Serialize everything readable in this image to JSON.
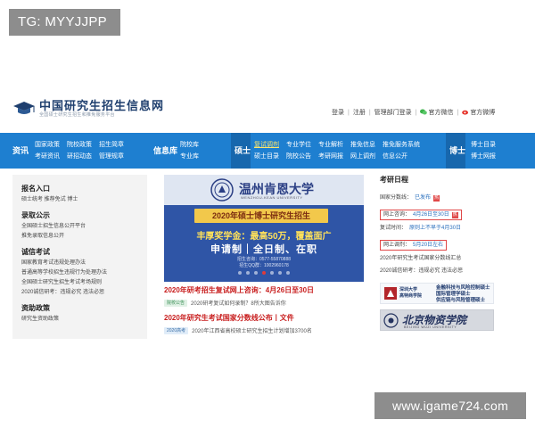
{
  "overlays": {
    "tag": "TG: MYYJJPP",
    "domain": "www.igame724.com"
  },
  "site": {
    "title": "中国研究生招生信息网",
    "subtitle": "全国硕士研究生招生和推免服务平台"
  },
  "top_links": {
    "login": "登录",
    "register": "注册",
    "admin_login": "管理部门登录",
    "wechat": "官方微信",
    "weibo": "官方微博"
  },
  "nav": {
    "groups": [
      {
        "head": "资讯",
        "items": [
          "国家政策",
          "考研资讯",
          "院校政策",
          "研招动态",
          "招生简章",
          "管理规章"
        ]
      },
      {
        "head": "信息库",
        "items": [
          "院校库",
          "专业库"
        ]
      },
      {
        "head": "硕士",
        "items": [
          "复试调剂",
          "硕士目录",
          "专业学位",
          "院校公告",
          "专业解析",
          "考研网报",
          "推免信息",
          "网上调剂",
          "推免服务系统",
          "信息公开"
        ]
      },
      {
        "head": "博士",
        "items": [
          "博士目录",
          "博士网报"
        ]
      }
    ]
  },
  "left": {
    "sections": [
      {
        "title": "报名入口",
        "items": [
          "硕士统考  推荐免试  博士"
        ]
      },
      {
        "title": "录取公示",
        "items": [
          "全国硕士招生信息公开平台",
          "推免录取信息公开"
        ]
      },
      {
        "title": "诚信考试",
        "items": [
          "国家教育考试违规处理办法",
          "普通高等学校招生违规行为处理办法",
          "全国硕士研究生招生考试考场规则",
          "2020诚信研考：违规必究 违法必惩"
        ]
      },
      {
        "title": "资助政策",
        "items": [
          "研究生资助政策"
        ]
      }
    ]
  },
  "banner": {
    "university": "温州肯恩大学",
    "university_en": "WENZHOU-KEAN UNIVERSITY",
    "ribbon": "2020年硕士博士研究生招生",
    "reward": "丰厚奖学金：最高50万，覆盖面广",
    "modes": "申请制｜全日制、在职",
    "phone": "招生咨询：0577-55870888",
    "qq": "招生QQ群：1002960178"
  },
  "news": [
    {
      "title": "2020年研考招生复试网上咨询：4月26日至30日",
      "chip": "院校公告",
      "text": "2020研考复试如何录制？8所大图告诉你"
    },
    {
      "title": "2020年研究生考试国家分数线公布丨文件",
      "chip": "2020高考",
      "text": "2020年江西省高校硕士研究生招生计划增加3700名"
    }
  ],
  "schedule": {
    "title": "考研日程",
    "items": [
      {
        "label": "国家分数线：",
        "value": "已发布",
        "hot": true,
        "boxed": false
      },
      {
        "label": "网上咨询：",
        "value": "4月26日至30日",
        "hot": true,
        "boxed": true
      },
      {
        "label": "复试时间：",
        "value": "原则上不早于4月30日",
        "hot": false,
        "boxed": false
      },
      {
        "label": "网上调剂：",
        "value": "5月20日左右",
        "hot": false,
        "boxed": true
      },
      {
        "label": "2020年研究生考试国家分数线汇总",
        "value": "",
        "hot": false,
        "boxed": false
      },
      {
        "label": "2020诚信研考：违规必究 违法必惩",
        "value": "",
        "hot": false,
        "boxed": false
      }
    ]
  },
  "ads": {
    "ad1": {
      "school": "深圳大学",
      "school_sub": "高特商学院",
      "line1": "金融科技与风险控制硕士",
      "line2": "国际管理学硕士",
      "line3": "供应链与风险管理硕士"
    },
    "ad2": {
      "main": "北京物资学院",
      "en": "BEIJING WUZI UNIVERSITY"
    }
  },
  "colors": {
    "nav_blue": "#1e7fd0",
    "headline_red": "#c81e1e",
    "link_blue": "#2a6fbd",
    "highlight_red": "#e04848"
  }
}
